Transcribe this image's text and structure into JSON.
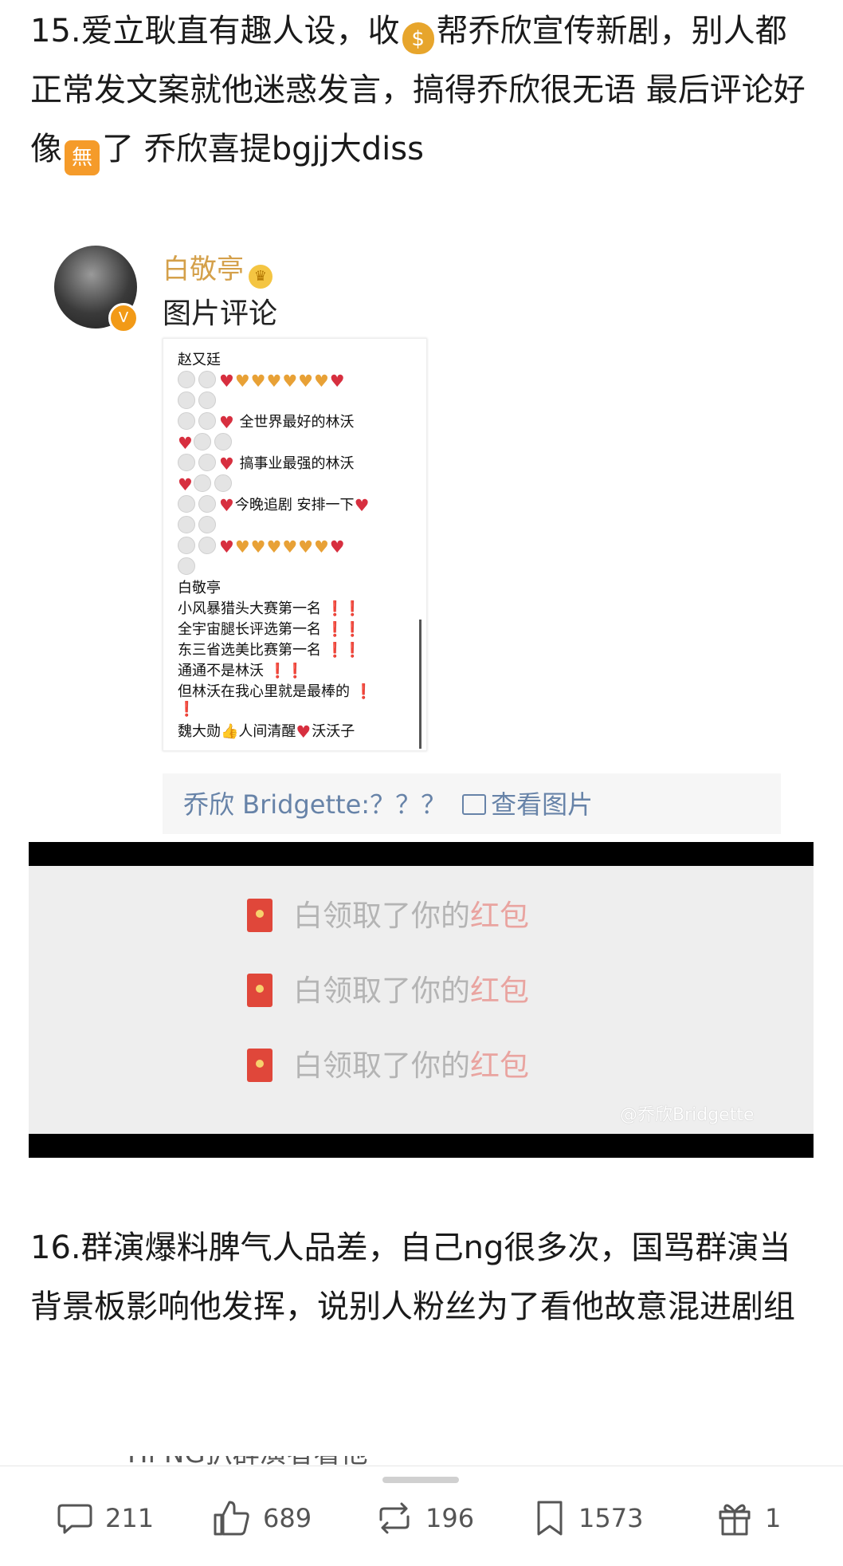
{
  "post": {
    "para15_a": "15.爱立耿直有趣人设，收",
    "para15_emoji": "$",
    "para15_b": "帮乔欣宣传新剧，别人都正常发文案就他迷惑发言，搞得乔欣很无语 最后评论好像",
    "para15_wu": "無",
    "para15_c": "了 乔欣喜提bgjj大diss",
    "para16": "16.群演爆料脾气人品差，自己ng很多次，国骂群演当背景板影响他发挥，说别人粉丝为了看他故意混进剧组",
    "cutoff_text": "Hi NG扒群演者看他"
  },
  "comment": {
    "username": "白敬亭",
    "crown_icon": "♛",
    "verified_icon": "V",
    "subtitle": "图片评论",
    "image_lines": {
      "l1": "赵又廷",
      "l3_text": "全世界最好的林沃",
      "l5_text": "搞事业最强的林沃",
      "l7_text": "今晚追剧  安排一下",
      "l10": "白敬亭",
      "l11": "小风暴猎头大赛第一名",
      "l12": "全宇宙腿长评选第一名",
      "l13": "东三省选美比赛第一名",
      "l14": "通通不是林沃",
      "l15": "但林沃在我心里就是最棒的",
      "l16_a": "魏大勋",
      "l16_b": "人间清醒",
      "l16_c": "沃沃子",
      "exclaim": "❗❗",
      "exclaim_one": "❗",
      "heart_red": "♥",
      "heart_yellow": "♥",
      "thumb": "👍"
    },
    "reply_author": "乔欣 Bridgette:",
    "reply_text": "？？？",
    "reply_link": "查看图片"
  },
  "redpacket": {
    "rows": [
      {
        "prefix": "白领取了你的",
        "highlight": "红包"
      },
      {
        "prefix": "白领取了你的",
        "highlight": "红包"
      },
      {
        "prefix": "白领取了你的",
        "highlight": "红包"
      }
    ],
    "watermark": "@乔欣Bridgette"
  },
  "actions": {
    "comments": "211",
    "likes": "689",
    "reposts": "196",
    "favorites": "1573",
    "gifts": "1"
  }
}
